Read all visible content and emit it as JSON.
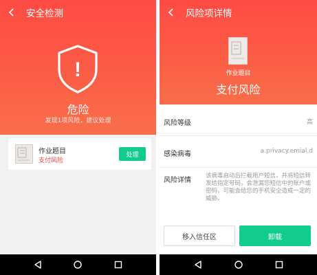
{
  "left": {
    "appbar": {
      "title": "安全检测",
      "back_icon": "chevron-left-icon"
    },
    "status": {
      "icon": "shield-exclamation-icon",
      "mark": "!",
      "title": "危险",
      "subtitle": "发现1项风险，建议处理"
    },
    "risk_item": {
      "icon": "app-thumbnail-icon",
      "name": "作业题目",
      "risk": "支付风险",
      "action": "处理"
    }
  },
  "right": {
    "appbar": {
      "title": "风险项详情",
      "back_icon": "chevron-left-icon"
    },
    "header": {
      "icon": "app-thumbnail-icon",
      "app_name": "作业题目",
      "risk_type": "支付风险"
    },
    "rows": {
      "level": {
        "label": "风险等级",
        "value": "高"
      },
      "virus": {
        "label": "感染病毒",
        "value": "a.privacy.emial.d"
      },
      "detail": {
        "label": "风险详情",
        "value": "该病毒启动后拦截用户短信，并将短信转发给指定号码，会泄漏您短信中的账户或密码，可能会给您的手机安全造成一定的威胁。"
      }
    },
    "buttons": {
      "trust": "移入信任区",
      "uninstall": "卸载"
    }
  },
  "navbar": {
    "back": "nav-back-icon",
    "home": "nav-home-icon",
    "recents": "nav-recents-icon"
  },
  "colors": {
    "gradient_top": "#ff4b45",
    "gradient_bottom": "#f96e4a",
    "accent_green": "#11cc8b",
    "risk_red": "#ec4135",
    "navbar": "#000000"
  }
}
